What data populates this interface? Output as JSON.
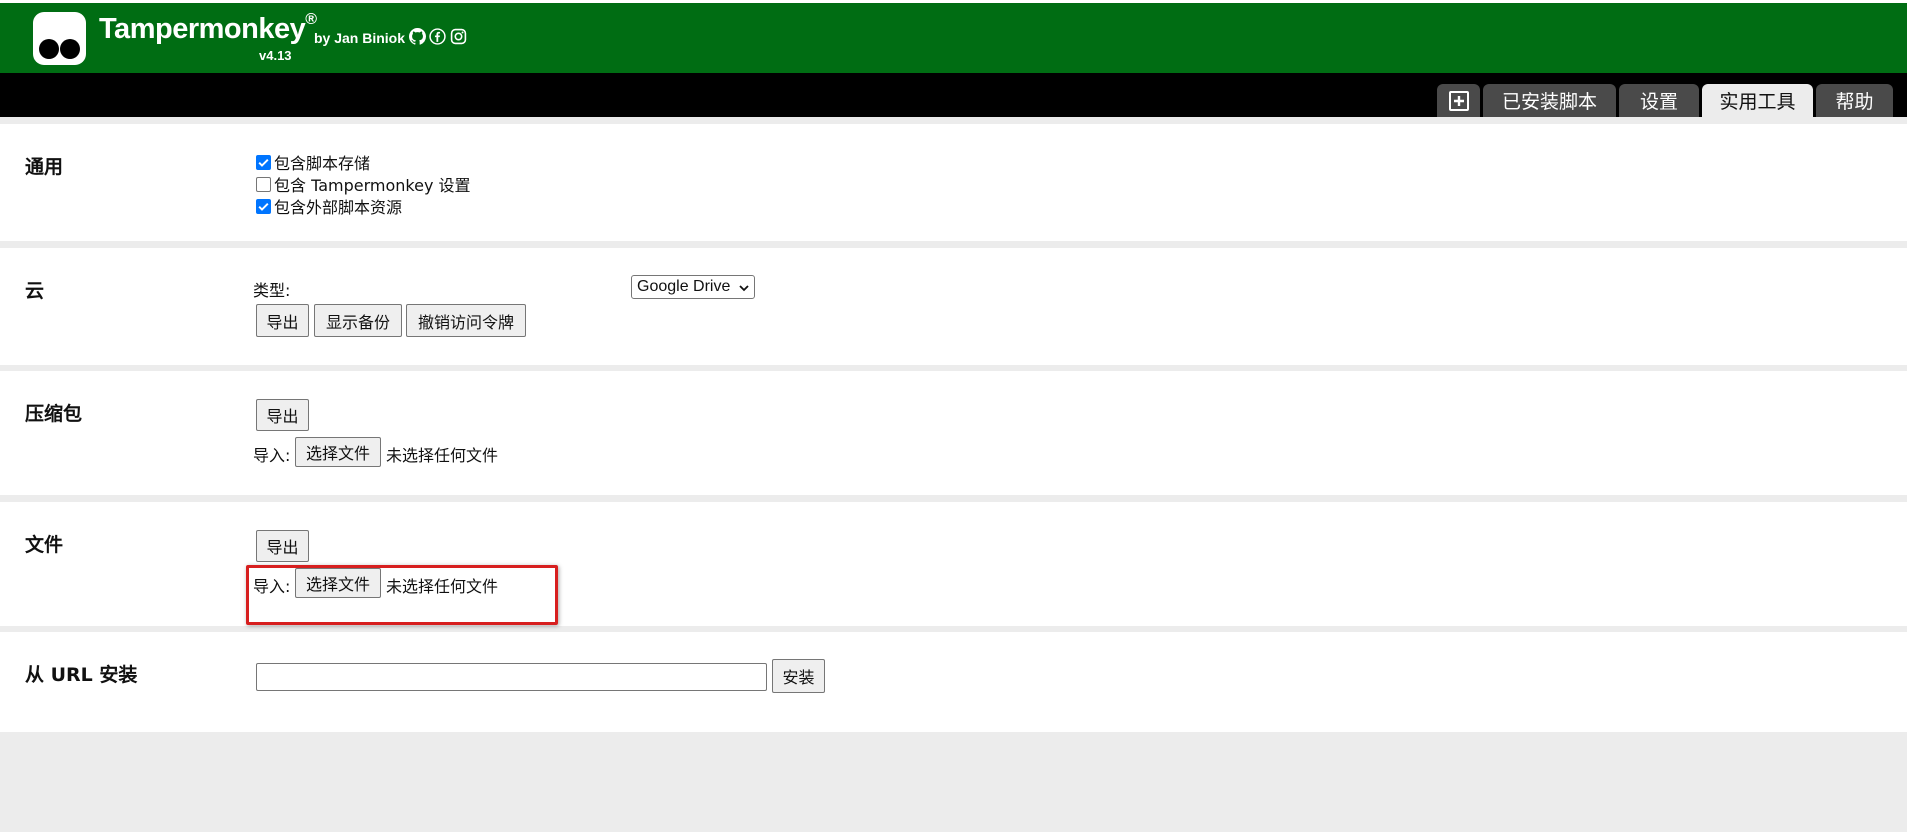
{
  "header": {
    "title": "Tampermonkey",
    "registered": "®",
    "version": "v4.13",
    "author": "by Jan Biniok",
    "social_icons": [
      "github-icon",
      "facebook-icon",
      "instagram-icon"
    ]
  },
  "tabs": {
    "add_icon": "plus-square-icon",
    "items": [
      {
        "label": "已安装脚本"
      },
      {
        "label": "设置"
      },
      {
        "label": "实用工具"
      },
      {
        "label": "帮助"
      }
    ],
    "active": "实用工具"
  },
  "sections": {
    "general": {
      "title": "通用",
      "options": [
        {
          "label": "包含脚本存储",
          "checked": true
        },
        {
          "label": "包含 Tampermonkey 设置",
          "checked": false
        },
        {
          "label": "包含外部脚本资源",
          "checked": true
        }
      ]
    },
    "cloud": {
      "title": "云",
      "type_label": "类型:",
      "type_value": "Google Drive",
      "buttons": {
        "export": "导出",
        "show_backup": "显示备份",
        "revoke": "撤销访问令牌"
      }
    },
    "zip": {
      "title": "压缩包",
      "export": "导出",
      "import_label": "导入:",
      "choose_file": "选择文件",
      "no_file": "未选择任何文件"
    },
    "file": {
      "title": "文件",
      "export": "导出",
      "import_label": "导入:",
      "choose_file": "选择文件",
      "no_file": "未选择任何文件"
    },
    "url": {
      "title": "从 URL 安装",
      "input_value": "",
      "install": "安装"
    }
  },
  "colors": {
    "header_green": "#006d13",
    "tabbar_black": "#000000",
    "highlight_red": "#d71f1f",
    "checkbox_blue": "#0075ff"
  }
}
